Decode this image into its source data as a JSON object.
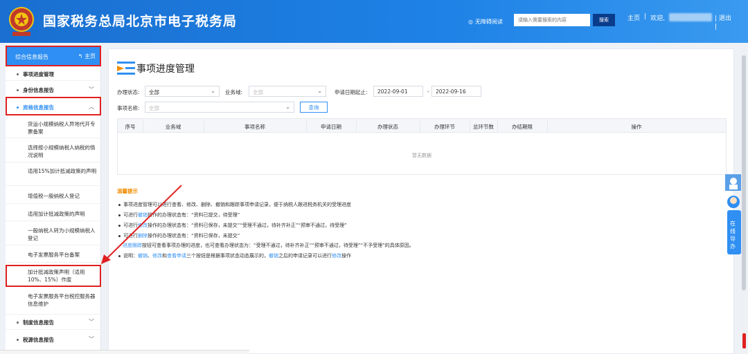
{
  "header": {
    "site_title": "国家税务总局北京市电子税务局",
    "accessibility": "无障碍阅读",
    "search_placeholder": "请输入需要搜索的内容",
    "search_button": "搜索",
    "home_link": "主页",
    "separator": "|",
    "welcome": "欢迎,",
    "logout": "退出"
  },
  "sidebar": {
    "head_label": "综合信息报告",
    "head_home": "主页",
    "items": [
      {
        "label": "事项进度管理"
      },
      {
        "label": "身份信息报告"
      },
      {
        "label": "资格信息报告"
      },
      {
        "label": "制度信息报告"
      },
      {
        "label": "税源信息报告"
      }
    ],
    "subitems": [
      "货运小规模纳税人异地代开专票备案",
      "选择按小规模纳税人纳税的情况说明",
      "适用15%加计抵减政策的声明",
      "增值税一般纳税人登记",
      "适用加计抵减政策的声明",
      "一般纳税人转为小规模纳税人登记",
      "电子发票服务平台备案",
      "加计抵减政策声明（适用10%、15%）作废",
      "电子发票服务平台税控服务器信息维护"
    ]
  },
  "main": {
    "title": "事项进度管理",
    "filters": {
      "status_label": "办理状态:",
      "status_value": "全部",
      "domain_label": "业务域:",
      "domain_value": "全部",
      "date_label": "申请日期起止:",
      "date_start": "2022-09-01",
      "date_dash": "-",
      "date_end": "2022-09-16",
      "item_label": "事项名称:",
      "item_value": "全部",
      "query_button": "查询"
    },
    "table": {
      "columns": [
        "序号",
        "业务域",
        "事项名称",
        "申请日期",
        "办理状态",
        "办理环节",
        "总环节数",
        "办结期限",
        "操作"
      ],
      "empty": "暂无数据"
    },
    "tips": {
      "title": "温馨提示",
      "lines": [
        [
          "事项进度管理可以进行查看、修改、删除、撤销和跟踪事项申请记录，便于纳税人跟进税务机关的受理进度"
        ],
        [
          "可进行",
          "撤销",
          "操作的办理状态有：“资料已提交，待受理”"
        ],
        [
          "可进行",
          "修改",
          "操作的办理状态有：“资料已保存，未提交”“受理不通过，待补齐补正”“预审不通过，待受理”"
        ],
        [
          "可进行",
          "删除",
          "操作的办理状态有：“资料已保存，未提交”"
        ],
        [
          "",
          "进度跟踪",
          "按钮可查看事项办理的进度，也可查看办理状态为：“受理不通过，待补齐补正”“预审不通过，待受理”“不予受理”的具体原因。"
        ],
        [
          "说明：",
          "撤销",
          "、",
          "修改",
          "和",
          "查看申请",
          "三个按钮是根据事项状态动态展示的，",
          "撤销",
          "之后的申请记录可以进行",
          "修改",
          "操作"
        ]
      ]
    }
  },
  "widget": {
    "online_guide": "在线导办"
  },
  "colors": {
    "header_blue": "#1e82e6",
    "accent_blue": "#2f8ff2",
    "highlight_red": "#e02020",
    "tip_orange": "#f08c00"
  }
}
